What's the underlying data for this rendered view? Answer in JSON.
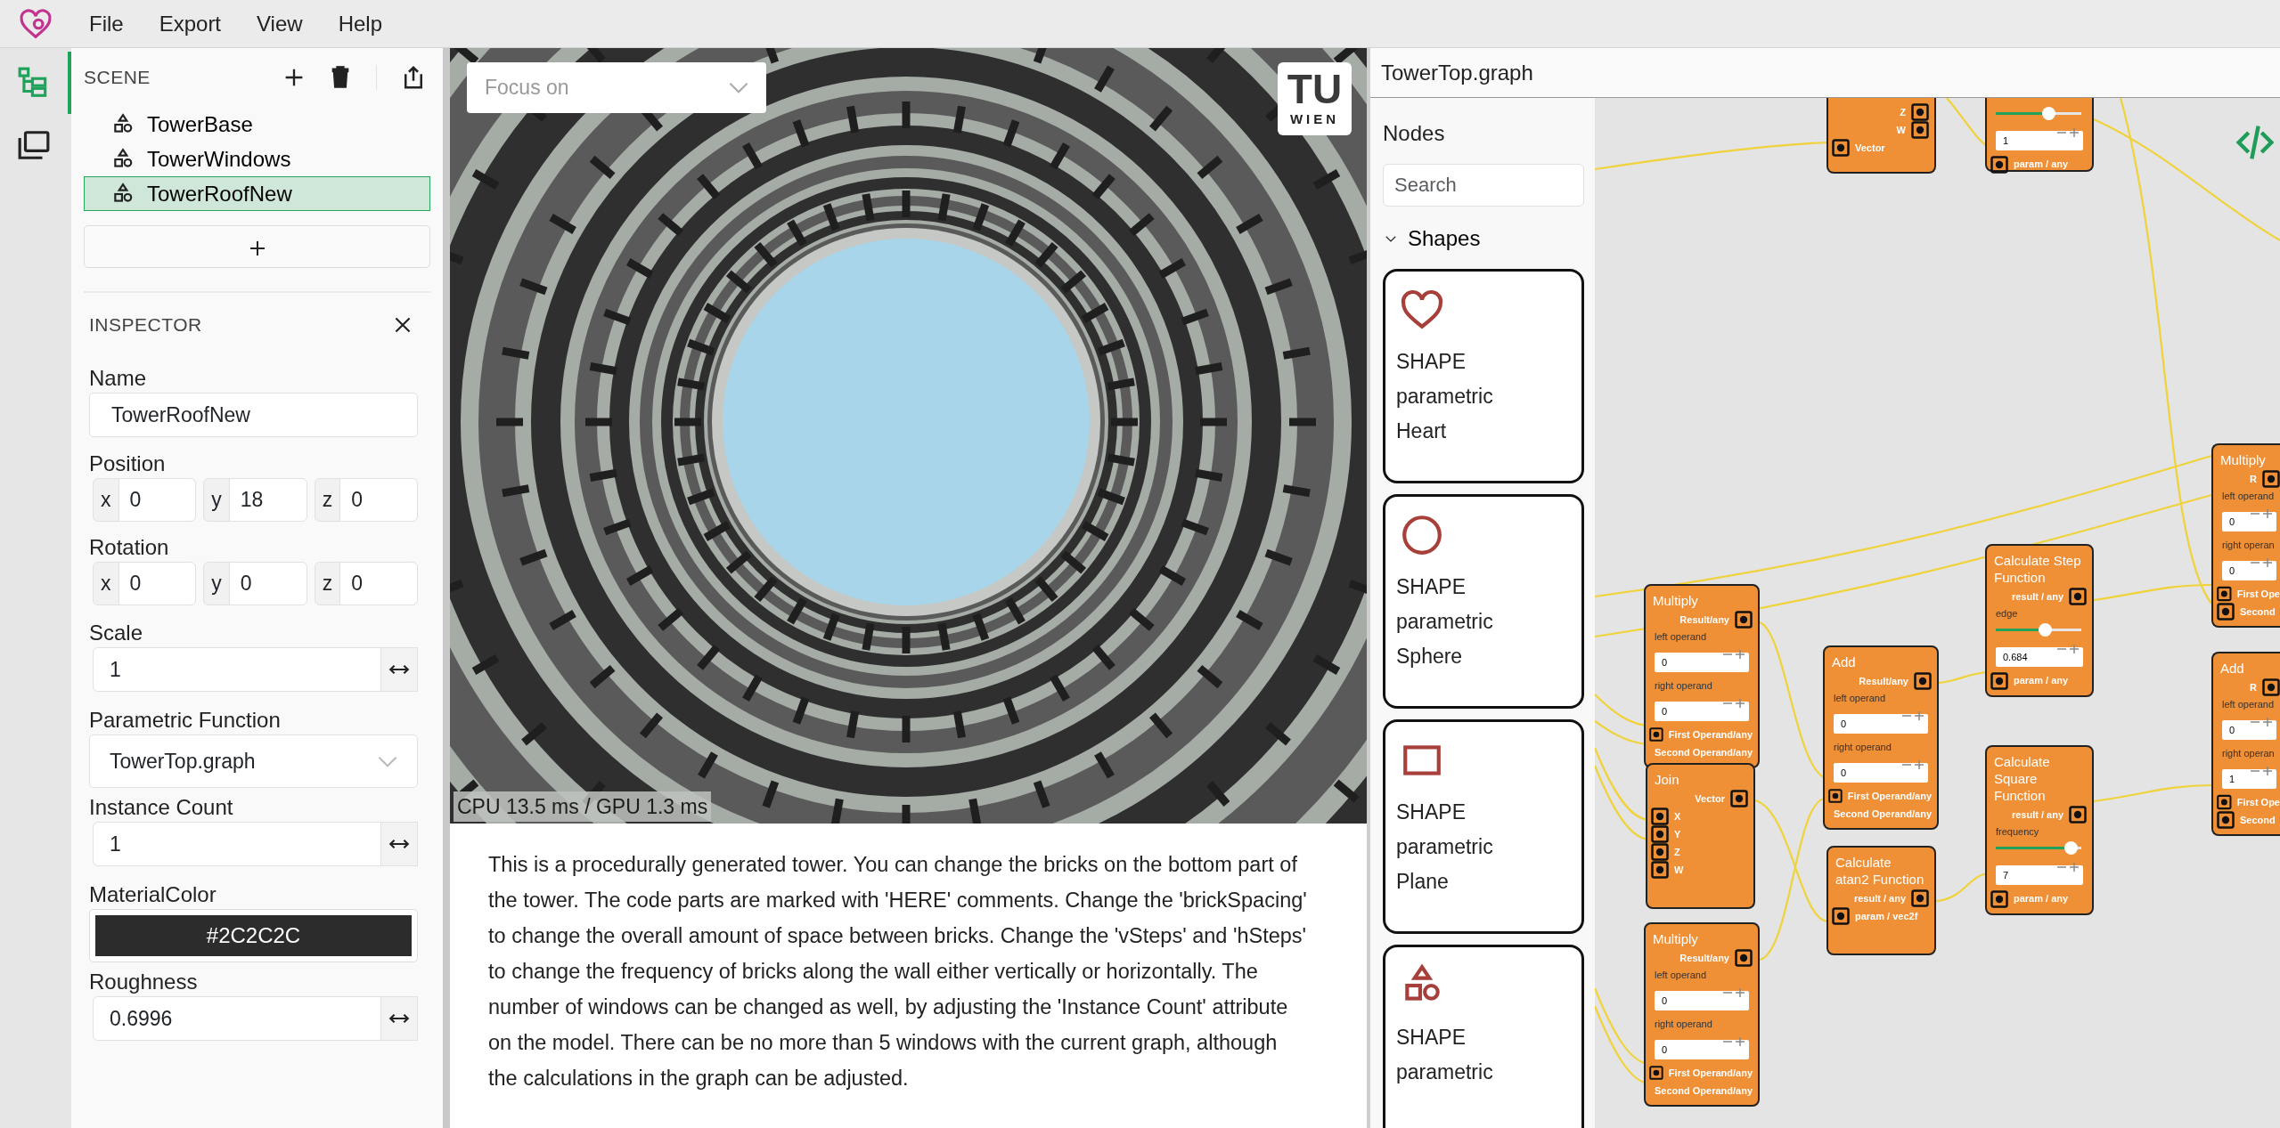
{
  "menu": {
    "items": [
      "File",
      "Export",
      "View",
      "Help"
    ]
  },
  "rail": [
    {
      "kind": "scene",
      "selected": true
    },
    {
      "kind": "files",
      "selected": false
    }
  ],
  "scene": {
    "title": "SCENE",
    "items": [
      {
        "label": "TowerBase",
        "selected": false
      },
      {
        "label": "TowerWindows",
        "selected": false
      },
      {
        "label": "TowerRoofNew",
        "selected": true
      }
    ]
  },
  "inspector": {
    "title": "INSPECTOR",
    "fields": [
      {
        "kind": "text",
        "label": "Name",
        "value": "TowerRoofNew"
      },
      {
        "kind": "vector",
        "label": "Position",
        "components": [
          {
            "axis": "x",
            "value": "0"
          },
          {
            "axis": "y",
            "value": "18"
          },
          {
            "axis": "z",
            "value": "0"
          }
        ]
      },
      {
        "kind": "vector",
        "label": "Rotation",
        "components": [
          {
            "axis": "x",
            "value": "0"
          },
          {
            "axis": "y",
            "value": "0"
          },
          {
            "axis": "z",
            "value": "0"
          }
        ]
      },
      {
        "kind": "number",
        "label": "Scale",
        "value": "1"
      },
      {
        "kind": "select",
        "label": "Parametric Function",
        "value": "TowerTop.graph"
      },
      {
        "kind": "number",
        "label": "Instance Count",
        "value": "1"
      },
      {
        "kind": "color",
        "label": "MaterialColor",
        "value": "#2C2C2C"
      },
      {
        "kind": "number",
        "label": "Roughness",
        "value": "0.6996"
      }
    ]
  },
  "viewport": {
    "focus_select": {
      "placeholder": "Focus on"
    },
    "logo": {
      "mark": "TU",
      "name": "WIEN"
    },
    "stats": "CPU 13.5 ms / GPU 1.3 ms"
  },
  "description": "This is a procedurally generated tower. You can change the bricks on the bottom part of the tower. The code parts are marked with 'HERE' comments. Change the 'brickSpacing' to change the overall amount of space between bricks. Change the 'vSteps' and 'hSteps' to change the frequency of bricks along the wall either vertically or horizontally. The number of windows can be changed as well, by adjusting the 'Instance Count' attribute on the model. There can be no more than 5 windows with the current graph, although the calculations in the graph can be adjusted.",
  "graph": {
    "title": "TowerTop.graph",
    "palette": {
      "title": "Nodes",
      "search": {
        "placeholder": "Search"
      },
      "groups": [
        {
          "label": "Shapes",
          "expanded": true,
          "items": [
            {
              "kind": "heart",
              "category": "SHAPE",
              "subtitle": "parametric",
              "name": "Heart"
            },
            {
              "kind": "sphere",
              "category": "SHAPE",
              "subtitle": "parametric",
              "name": "Sphere"
            },
            {
              "kind": "plane",
              "category": "SHAPE",
              "subtitle": "parametric",
              "name": "Plane"
            },
            {
              "kind": "shapes",
              "category": "SHAPE",
              "subtitle": "parametric"
            }
          ]
        }
      ]
    },
    "nodes": [
      {
        "rows": [
          {
            "kind": "output",
            "label": "Z"
          },
          {
            "kind": "output",
            "label": "W"
          },
          {
            "kind": "input",
            "label": "Vector"
          }
        ]
      },
      {
        "rows": [
          {
            "kind": "slider",
            "level": 0.54
          },
          {
            "kind": "number",
            "value": "1"
          },
          {
            "kind": "input",
            "label": "param / any"
          }
        ]
      },
      {
        "title": "Multiply",
        "rows": [
          {
            "kind": "output",
            "label": "Result/any"
          },
          {
            "kind": "label",
            "label": "left operand"
          },
          {
            "kind": "number",
            "value": "0"
          },
          {
            "kind": "label",
            "label": "right operand"
          },
          {
            "kind": "number",
            "value": "0"
          },
          {
            "kind": "input",
            "label": "First Operand/any"
          },
          {
            "kind": "input",
            "label": "Second Operand/any"
          }
        ]
      },
      {
        "title": "Add",
        "rows": [
          {
            "kind": "output",
            "label": "Result/any"
          },
          {
            "kind": "label",
            "label": "left operand"
          },
          {
            "kind": "number",
            "value": "0"
          },
          {
            "kind": "label",
            "label": "right operand"
          },
          {
            "kind": "number",
            "value": "0"
          },
          {
            "kind": "input",
            "label": "First Operand/any"
          },
          {
            "kind": "input",
            "label": "Second Operand/any"
          }
        ]
      },
      {
        "title": "Calculate Step Function",
        "rows": [
          {
            "kind": "output",
            "label": "result / any"
          },
          {
            "kind": "label",
            "label": "edge"
          },
          {
            "kind": "slider",
            "level": 0.5
          },
          {
            "kind": "number",
            "value": "0.684"
          },
          {
            "kind": "input",
            "label": "param / any"
          }
        ]
      },
      {
        "title": "Join",
        "rows": [
          {
            "kind": "output",
            "label": "Vector"
          },
          {
            "kind": "input",
            "label": "X"
          },
          {
            "kind": "input",
            "label": "Y"
          },
          {
            "kind": "input",
            "label": "Z"
          },
          {
            "kind": "input",
            "label": "W"
          }
        ]
      },
      {
        "title": "Calculate atan2 Function",
        "rows": [
          {
            "kind": "output",
            "label": "result / any"
          },
          {
            "kind": "input",
            "label": "param / vec2f"
          }
        ]
      },
      {
        "title": "Calculate Square Function",
        "rows": [
          {
            "kind": "output",
            "label": "result / any"
          },
          {
            "kind": "label",
            "label": "frequency"
          },
          {
            "kind": "slider",
            "level": 0.8
          },
          {
            "kind": "number",
            "value": "7"
          },
          {
            "kind": "input",
            "label": "param / any"
          }
        ]
      },
      {
        "title": "Multiply",
        "rows": [
          {
            "kind": "output",
            "label": "Result/any"
          },
          {
            "kind": "label",
            "label": "left operand"
          },
          {
            "kind": "number",
            "value": "0"
          },
          {
            "kind": "label",
            "label": "right operand"
          },
          {
            "kind": "number",
            "value": "0"
          },
          {
            "kind": "input",
            "label": "First Operand/any"
          },
          {
            "kind": "input",
            "label": "Second Operand/any"
          }
        ]
      },
      {
        "title": "Multiply",
        "rows": [
          {
            "kind": "output",
            "label": "R"
          },
          {
            "kind": "label",
            "label": "left operand"
          },
          {
            "kind": "number",
            "value": "0"
          },
          {
            "kind": "label",
            "label": "right operan"
          },
          {
            "kind": "number",
            "value": "0"
          },
          {
            "kind": "input",
            "label": "First Ope"
          },
          {
            "kind": "input",
            "label": "Second"
          }
        ]
      },
      {
        "title": "Add",
        "rows": [
          {
            "kind": "output",
            "label": "R"
          },
          {
            "kind": "label",
            "label": "left operand"
          },
          {
            "kind": "number",
            "value": "0"
          },
          {
            "kind": "label",
            "label": "right operan"
          },
          {
            "kind": "number",
            "value": "1"
          },
          {
            "kind": "input",
            "label": "First Ope"
          },
          {
            "kind": "input",
            "label": "Second"
          }
        ]
      }
    ]
  }
}
